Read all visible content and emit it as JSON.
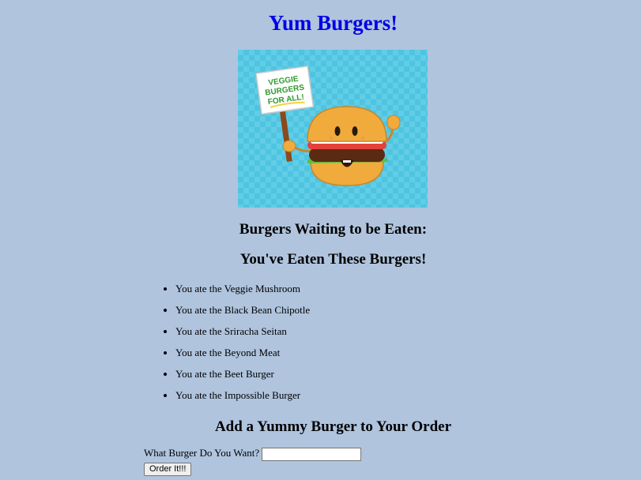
{
  "page": {
    "title": "Yum Burgers!"
  },
  "hero": {
    "sign_lines": [
      "VEGGIE",
      "BURGERS",
      "FOR ALL!"
    ],
    "background_color": "#4fc4e1",
    "bun_color": "#f0ab3c",
    "patty_color": "#5a2b12",
    "lettuce_color": "#5dbf3e",
    "tomato_color": "#e5413a"
  },
  "sections": {
    "waiting_heading": "Burgers Waiting to be Eaten:",
    "eaten_heading": "You've Eaten These Burgers!",
    "add_heading": "Add a Yummy Burger to Your Order"
  },
  "eaten_burgers": [
    "You ate the Veggie Mushroom",
    "You ate the Black Bean Chipotle",
    "You ate the Sriracha Seitan",
    "You ate the Beyond Meat",
    "You ate the Beet Burger",
    "You ate the Impossible Burger"
  ],
  "order_form": {
    "label": "What Burger Do You Want?",
    "input_value": "",
    "button_label": "Order It!!!"
  }
}
